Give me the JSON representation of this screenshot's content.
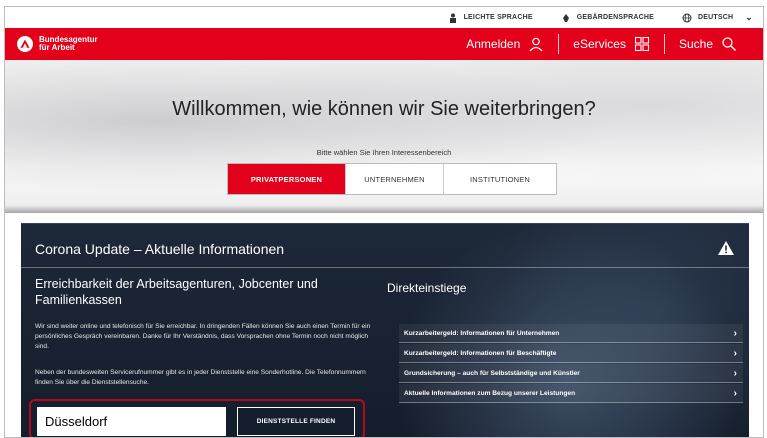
{
  "utility_bar": {
    "easy_language": "LEICHTE SPRACHE",
    "sign_language": "GEBÄRDENSPRACHE",
    "language": "DEUTSCH"
  },
  "header": {
    "logo_line1": "Bundesagentur",
    "logo_line2": "für Arbeit",
    "login": "Anmelden",
    "eservices": "eServices",
    "search": "Suche",
    "brand_color": "#e2001a"
  },
  "hero": {
    "title": "Willkommen, wie können wir Sie weiterbringen?",
    "subtitle": "Bitte wählen Sie Ihren Interessenbereich",
    "tabs": [
      {
        "label": "PRIVATPERSONEN",
        "active": true
      },
      {
        "label": "UNTERNEHMEN",
        "active": false
      },
      {
        "label": "INSTITUTIONEN",
        "active": false
      }
    ]
  },
  "corona": {
    "title": "Corona Update – Aktuelle Informationen",
    "heading": "Erreichbarkeit der Arbeitsagenturen, Jobcenter und Familienkassen",
    "paragraph1": "Wir sind weiter online und telefonisch für Sie erreichbar. In dringenden Fällen können Sie auch einen Termin für ein persönliches Gespräch vereinbaren. Danke für Ihr Verständnis, dass Vorsprachen ohne Termin noch nicht möglich sind.",
    "paragraph2": "Neben der bundesweiten Servicerufnummer gibt es in jeder Dienststelle eine Sonderhotline. Die Telefonnummern finden Sie über die Dienststellensuche.",
    "search_value": "Düsseldorf",
    "find_button": "DIENSTSTELLE FINDEN",
    "direct_heading": "Direkteinstiege",
    "direct_links": [
      "Kurzarbeitergeld: Informationen für Unternehmen",
      "Kurzarbeitergeld: Informationen für Beschäftigte",
      "Grundsicherung – auch für Selbstständige und Künstler",
      "Aktuelle Informationen zum Bezug unserer Leistungen"
    ]
  }
}
